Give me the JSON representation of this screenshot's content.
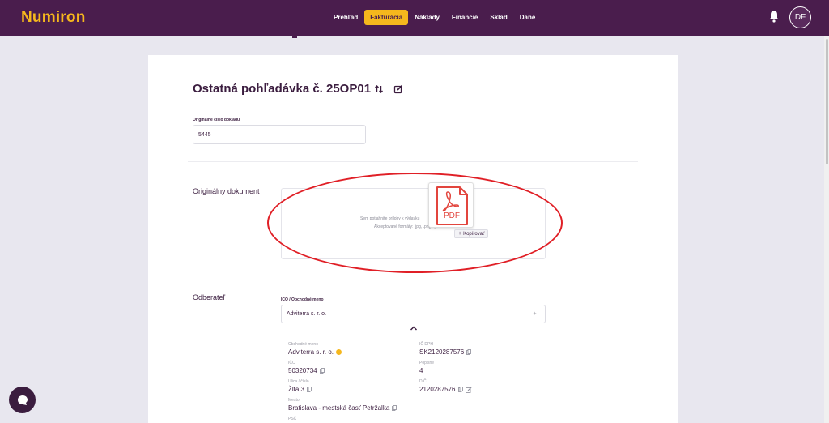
{
  "app": {
    "brand": "Numiron"
  },
  "nav": {
    "items": [
      {
        "label": "Prehľad",
        "active": false
      },
      {
        "label": "Fakturácia",
        "active": true
      },
      {
        "label": "Náklady",
        "active": false
      },
      {
        "label": "Financie",
        "active": false
      },
      {
        "label": "Sklad",
        "active": false
      },
      {
        "label": "Dane",
        "active": false
      }
    ]
  },
  "user": {
    "initials": "DF"
  },
  "document": {
    "title": "Ostatná pohľadávka č. 25OP01",
    "original_number_label": "Originálne číslo dokladu",
    "original_number_value": "5445"
  },
  "original_document": {
    "section_label": "Originálny dokument",
    "drop_text": "Sem potiahnite prílohy k výdavku",
    "accepted_formats": "Akceptované formáty: .jpg, .png, .pdf",
    "file_type": "PDF",
    "copy_label": "Kopírovať"
  },
  "customer": {
    "section_label": "Odberateľ",
    "search_label": "IČO / Obchodné meno",
    "search_value": "Adviterra s. r. o.",
    "fields": {
      "business_name_label": "Obchodné meno",
      "business_name": "Adviterra s. r. o.",
      "vat_id_label": "IČ DPH",
      "vat_id": "SK2120287576",
      "ico_label": "IČO",
      "ico": "50320734",
      "house_number_label": "Popisné",
      "house_number": "4",
      "street_label": "Ulica / číslo",
      "street": "Žltá 3",
      "dic_label": "DIČ",
      "dic": "2120287576",
      "city_label": "Mesto",
      "city": "Bratislava - mestská časť Petržalka",
      "zip_label": "PSČ"
    }
  },
  "colors": {
    "brand_purple": "#4a1d4d",
    "accent_yellow": "#f5b71d",
    "highlight_red": "#e01f26",
    "pdf_red": "#e2453d"
  }
}
